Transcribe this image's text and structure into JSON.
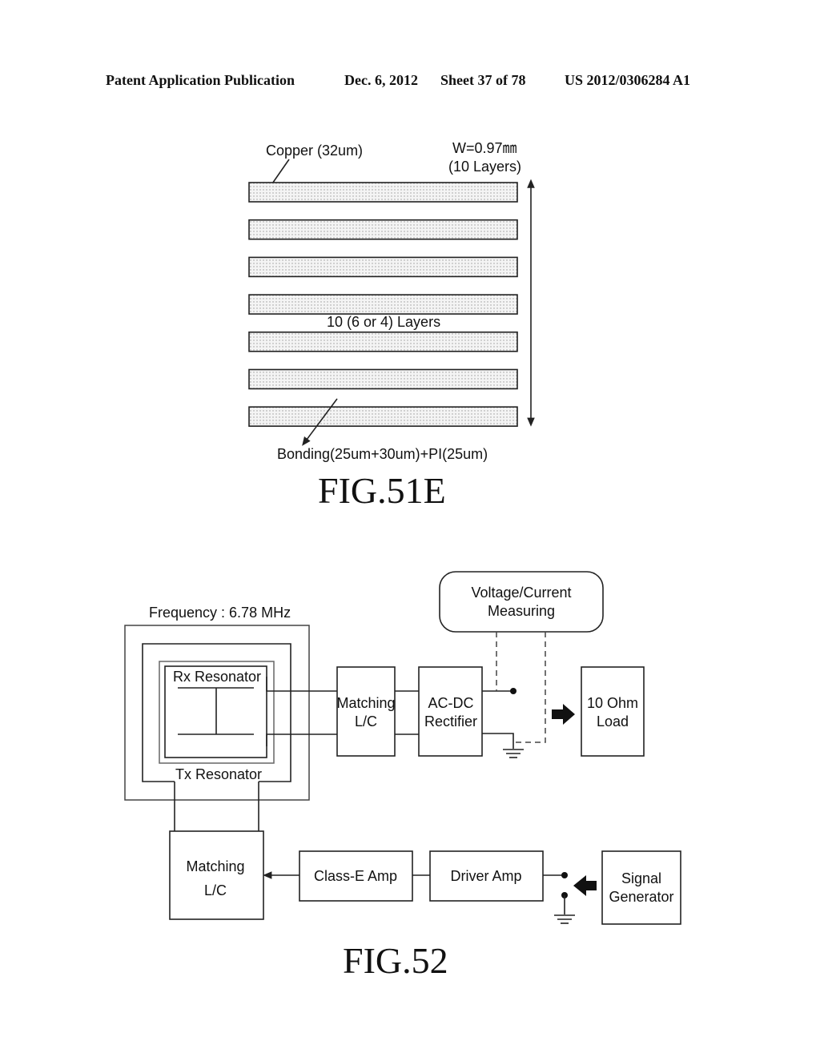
{
  "header": {
    "publication": "Patent Application Publication",
    "date": "Dec. 6, 2012",
    "sheet": "Sheet 37 of 78",
    "number": "US 2012/0306284 A1"
  },
  "fig51e": {
    "caption": "FIG.51E",
    "copper_label": "Copper (32um)",
    "width_label": "W=0.97㎜",
    "layers_count_label": "(10 Layers)",
    "layers_label": "10 (6 or 4) Layers",
    "bonding_label": "Bonding(25um+30um)+PI(25um)",
    "layer_count_drawn": 7
  },
  "fig52": {
    "caption": "FIG.52",
    "frequency_label": "Frequency : 6.78 MHz",
    "rx_resonator": "Rx Resonator",
    "tx_resonator": "Tx Resonator",
    "measuring": {
      "line1": "Voltage/Current",
      "line2": "Measuring"
    },
    "rx_matching": {
      "line1": "Matching",
      "line2": "L/C"
    },
    "rectifier": {
      "line1": "AC-DC",
      "line2": "Rectifier"
    },
    "load": {
      "line1": "10 Ohm",
      "line2": "Load"
    },
    "tx_matching": {
      "line1": "Matching",
      "line2": "L/C"
    },
    "class_e_amp": "Class-E Amp",
    "driver_amp": "Driver Amp",
    "signal_generator": {
      "line1": "Signal",
      "line2": "Generator"
    }
  }
}
